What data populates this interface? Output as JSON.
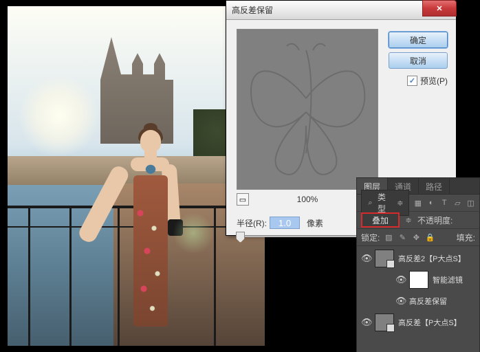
{
  "dialog": {
    "title": "高反差保留",
    "ok": "确定",
    "cancel": "取消",
    "preview_label": "预览(P)",
    "zoom": "100%",
    "radius_label": "半径(R):",
    "radius_value": "1.0",
    "radius_unit": "像素"
  },
  "panels": {
    "tabs": {
      "layers": "图层",
      "channels": "通道",
      "paths": "路径"
    },
    "type_label": "类型",
    "blend_mode": "叠加",
    "opacity_label": "不透明度:",
    "lock_label": "锁定:",
    "fill_label": "填充:",
    "layers": [
      {
        "name": "高反差2【P大点S】"
      },
      {
        "name": "智能滤镜"
      },
      {
        "name": "高反差保留"
      },
      {
        "name": "高反差【P大点S】"
      }
    ]
  }
}
